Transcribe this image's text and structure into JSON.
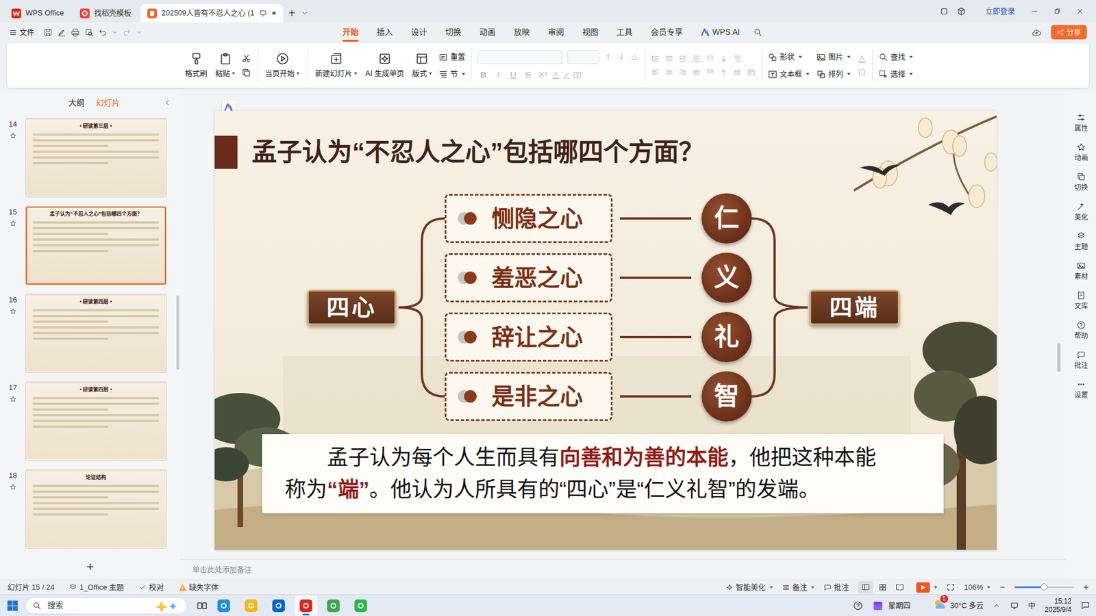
{
  "tabbar": {
    "tabs": [
      {
        "label": "WPS Office",
        "selected": false,
        "color": "#d9261c"
      },
      {
        "label": "找稻壳模板",
        "selected": false,
        "color": "#e8453c"
      },
      {
        "label": "202509人皆有不忍人之心 (1",
        "selected": true,
        "color": "#ee6b22"
      }
    ],
    "new_tab": "+",
    "login": "立即登录"
  },
  "menubar": {
    "file": "文件",
    "tabs": [
      {
        "label": "开始",
        "selected": true
      },
      {
        "label": "插入",
        "selected": false
      },
      {
        "label": "设计",
        "selected": false
      },
      {
        "label": "切换",
        "selected": false
      },
      {
        "label": "动画",
        "selected": false
      },
      {
        "label": "放映",
        "selected": false
      },
      {
        "label": "审阅",
        "selected": false
      },
      {
        "label": "视图",
        "selected": false
      },
      {
        "label": "工具",
        "selected": false
      },
      {
        "label": "会员专享",
        "selected": false
      },
      {
        "label": "WPS AI",
        "selected": false
      }
    ],
    "share": "分享"
  },
  "ribbon": {
    "clipboard": [
      {
        "label": "格式刷",
        "dropdown": false
      },
      {
        "label": "粘贴",
        "dropdown": true
      }
    ],
    "play": {
      "label": "当页开始",
      "dropdown": true
    },
    "slides": [
      {
        "label": "新建幻灯片",
        "dropdown": true
      },
      {
        "label": "AI 生成单页",
        "dropdown": false
      },
      {
        "label": "版式",
        "dropdown": true
      }
    ],
    "slide_small": [
      {
        "label": "重置",
        "dropdown": false
      },
      {
        "label": "节",
        "dropdown": true
      }
    ],
    "font": {
      "disabled": true,
      "styles": [
        "B",
        "I",
        "U",
        "S",
        "X²"
      ]
    },
    "insert_small": [
      {
        "label": "形状",
        "dropdown": true
      },
      {
        "label": "图片",
        "dropdown": true
      },
      {
        "label": "文本框",
        "dropdown": true
      },
      {
        "label": "排列",
        "dropdown": true
      }
    ],
    "edit_small": [
      {
        "label": "查找",
        "dropdown": true
      },
      {
        "label": "选择",
        "dropdown": true
      }
    ]
  },
  "left_panel": {
    "tabs": [
      {
        "label": "大纲",
        "selected": false
      },
      {
        "label": "幻灯片",
        "selected": true
      }
    ],
    "slides": [
      {
        "number": "14",
        "title": "• 研读第三层 •",
        "selected": false
      },
      {
        "number": "15",
        "title": "孟子认为“不忍人之心”包括哪四个方面？",
        "selected": true
      },
      {
        "number": "16",
        "title": "• 研读第四层 •",
        "selected": false
      },
      {
        "number": "17",
        "title": "• 研读第四层 •",
        "selected": false
      },
      {
        "number": "18",
        "title": "论证结构",
        "selected": false
      }
    ],
    "add": "+"
  },
  "slide": {
    "title": "孟子认为“不忍人之心”包括哪四个方面？",
    "left_label": "四心",
    "right_label": "四端",
    "rows": [
      {
        "heart": "恻隐之心",
        "virtue": "仁"
      },
      {
        "heart": "羞恶之心",
        "virtue": "义"
      },
      {
        "heart": "辞让之心",
        "virtue": "礼"
      },
      {
        "heart": "是非之心",
        "virtue": "智"
      }
    ],
    "caption": [
      [
        {
          "text": "孟子认为每个人生而具有",
          "emphasis": false
        },
        {
          "text": "向善和为善的本能",
          "emphasis": true
        },
        {
          "text": "，他把这种本能",
          "emphasis": false
        }
      ],
      [
        {
          "text": "称为",
          "emphasis": false
        },
        {
          "text": "“端”",
          "emphasis": true
        },
        {
          "text": "。他认为人所具有的“四心”是“仁义礼智”的发端。",
          "emphasis": false
        }
      ]
    ]
  },
  "notes": {
    "placeholder": "单击此处添加备注"
  },
  "right_sidebar": {
    "items": [
      "属性",
      "动画",
      "切换",
      "美化",
      "主题",
      "素材",
      "文库",
      "帮助",
      "批注",
      "设置"
    ]
  },
  "status_bar": {
    "slide": "幻灯片 15 / 24",
    "theme": "1_Office 主题",
    "proof": "校对",
    "missing_font": "缺失字体",
    "beautify": "智能美化",
    "notes": "备注",
    "comments": "批注",
    "views": [
      {
        "selected": true
      },
      {
        "selected": false
      },
      {
        "selected": false
      }
    ],
    "zoom": "106%",
    "zoom_out": "−",
    "zoom_in": "+",
    "zoom_level": 0.5
  },
  "taskbar": {
    "search": "搜索",
    "apps": [
      {
        "selected": false,
        "color": "#1e8fd6"
      },
      {
        "selected": false,
        "color": "#f2b81c"
      },
      {
        "selected": false,
        "color": "#0a64c8"
      },
      {
        "selected": true,
        "color": "#d9261c"
      },
      {
        "selected": false,
        "color": "#3aa84a"
      },
      {
        "selected": false,
        "color": "#2fb54a"
      }
    ],
    "day": "星期四",
    "weather": {
      "badge": "1",
      "temp": "30°C 多云"
    },
    "ime": "中",
    "time": "15:12",
    "date": "2025/9/4"
  }
}
